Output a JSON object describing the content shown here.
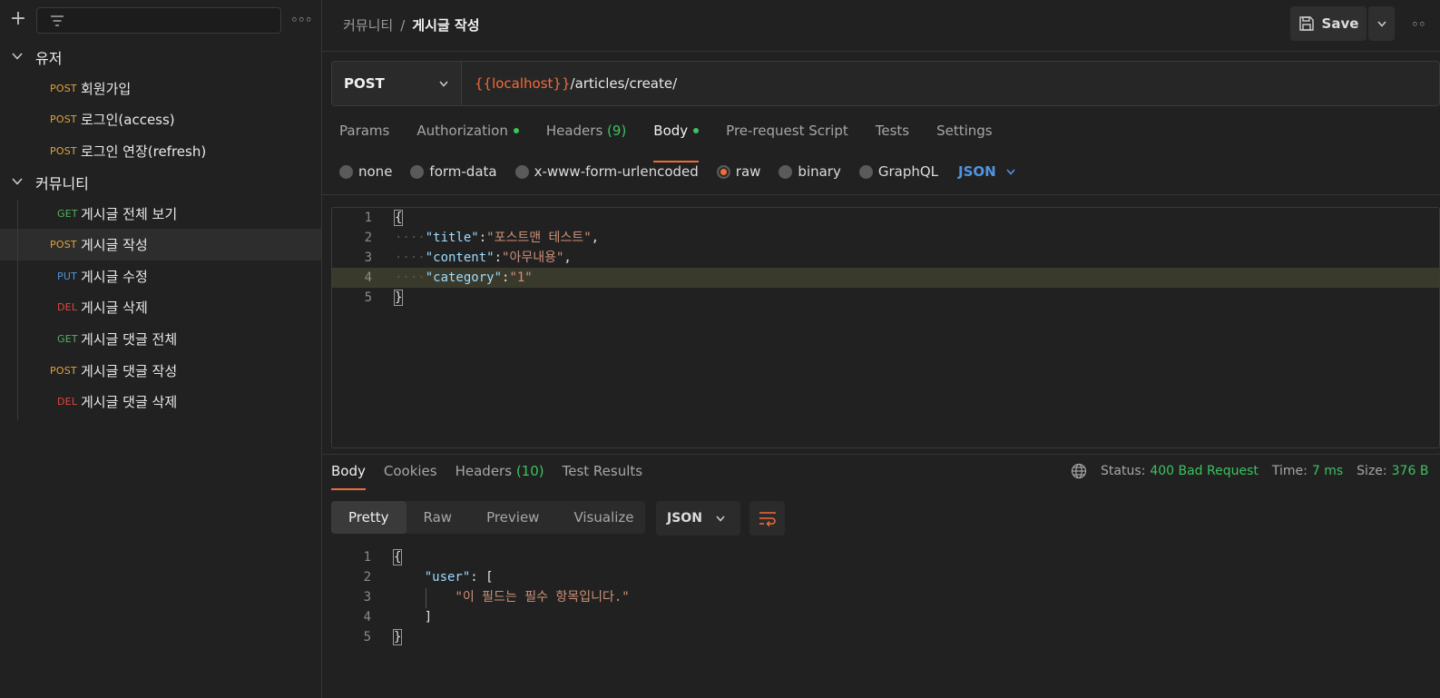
{
  "sidebar": {
    "folders": [
      {
        "name": "유저",
        "requests": [
          {
            "method": "POST",
            "name": "회원가입"
          },
          {
            "method": "POST",
            "name": "로그인(access)"
          },
          {
            "method": "POST",
            "name": "로그인 연장(refresh)"
          }
        ]
      },
      {
        "name": "커뮤니티",
        "requests": [
          {
            "method": "GET",
            "name": "게시글 전체 보기"
          },
          {
            "method": "POST",
            "name": "게시글 작성"
          },
          {
            "method": "PUT",
            "name": "게시글 수정"
          },
          {
            "method": "DEL",
            "name": "게시글 삭제"
          },
          {
            "method": "GET",
            "name": "게시글 댓글 전체"
          },
          {
            "method": "POST",
            "name": "게시글 댓글 작성"
          },
          {
            "method": "DEL",
            "name": "게시글 댓글 삭제"
          }
        ]
      }
    ]
  },
  "header": {
    "breadcrumb_parent": "커뮤니티",
    "breadcrumb_sep": "/",
    "breadcrumb_current": "게시글 작성",
    "save_label": "Save"
  },
  "request": {
    "method": "POST",
    "url_var": "{{localhost}}",
    "url_path": "/articles/create/",
    "tabs": {
      "params": "Params",
      "authorization": "Authorization",
      "headers": "Headers",
      "headers_count": "(9)",
      "body": "Body",
      "prerequest": "Pre-request Script",
      "tests": "Tests",
      "settings": "Settings"
    },
    "body_types": {
      "none": "none",
      "form_data": "form-data",
      "urlencoded": "x-www-form-urlencoded",
      "raw": "raw",
      "binary": "binary",
      "graphql": "GraphQL",
      "format": "JSON"
    },
    "body_lines": {
      "n1": "1",
      "n2": "2",
      "n3": "3",
      "n4": "4",
      "n5": "5",
      "open": "{",
      "k1": "\"title\"",
      "v1": "\"포스트맨 테스트\"",
      "k2": "\"content\"",
      "v2": "\"아무내용\"",
      "k3": "\"category\"",
      "v3": "\"1\"",
      "close": "}"
    }
  },
  "response": {
    "tabs": {
      "body": "Body",
      "cookies": "Cookies",
      "headers": "Headers",
      "headers_count": "(10)",
      "tests": "Test Results"
    },
    "status_label": "Status:",
    "status_value": "400 Bad Request",
    "time_label": "Time:",
    "time_value": "7 ms",
    "size_label": "Size:",
    "size_value": "376 B",
    "views": {
      "pretty": "Pretty",
      "raw": "Raw",
      "preview": "Preview",
      "visualize": "Visualize"
    },
    "format": "JSON",
    "body_lines": {
      "n1": "1",
      "n2": "2",
      "n3": "3",
      "n4": "4",
      "n5": "5",
      "open": "{",
      "key": "\"user\"",
      "arr_open": "[",
      "msg": "\"이 필드는 필수 항목입니다.\"",
      "arr_close": "]",
      "close": "}"
    }
  },
  "colors": {
    "accent": "#f26b3a",
    "post": "#e0a53a",
    "get": "#53b15e",
    "put": "#4f95e0",
    "del": "#e0473e",
    "success": "#3cc25f"
  }
}
